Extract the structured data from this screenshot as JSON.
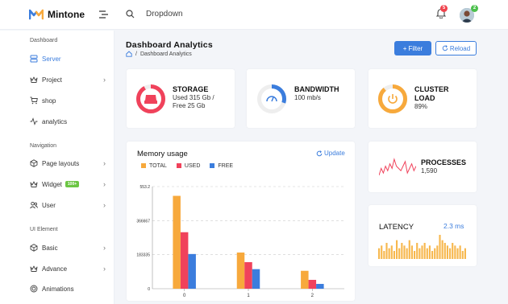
{
  "app": {
    "name": "Mintone"
  },
  "header": {
    "search_placeholder": "Dropdown",
    "notifications_count": "5",
    "profile_badge": "2"
  },
  "sidebar": {
    "sections": [
      {
        "title": "Dashboard"
      },
      {
        "title": "Navigation"
      },
      {
        "title": "UI Element"
      }
    ],
    "items": [
      {
        "label": "Server",
        "icon": "server-icon"
      },
      {
        "label": "Project",
        "icon": "crown-icon"
      },
      {
        "label": "shop",
        "icon": "cart-icon"
      },
      {
        "label": "analytics",
        "icon": "pulse-icon"
      },
      {
        "label": "Page layouts",
        "icon": "box-icon"
      },
      {
        "label": "Widget",
        "icon": "crown-icon",
        "tag": "100+"
      },
      {
        "label": "User",
        "icon": "users-icon"
      },
      {
        "label": "Basic",
        "icon": "box-icon"
      },
      {
        "label": "Advance",
        "icon": "crown-icon"
      },
      {
        "label": "Animations",
        "icon": "target-icon"
      }
    ]
  },
  "page": {
    "title": "Dashboard Analytics",
    "breadcrumb": {
      "sep": "/",
      "current": "Dashboard Analytics"
    },
    "filter_label": "Filter",
    "reload_label": "Reload"
  },
  "stats": {
    "storage": {
      "title": "STORAGE",
      "line1": "Used 315 Gb /",
      "line2": "Free 25 Gb",
      "color": "#f0425b",
      "progress": 0.92
    },
    "bandwidth": {
      "title": "BANDWIDTH",
      "value": "100 mb/s",
      "color": "#3b7ddd",
      "progress": 0.3
    },
    "cluster": {
      "title1": "CLUSTER",
      "title2": "LOAD",
      "value": "89%",
      "color": "#f7a93c",
      "progress": 0.89
    },
    "processes": {
      "title": "PROCESSES",
      "value": "1,590",
      "color": "#f0425b"
    },
    "latency": {
      "title": "LATENCY",
      "value": "2.3 ms",
      "color": "#f7b84e"
    }
  },
  "memory": {
    "title": "Memory usage",
    "update_label": "Update",
    "legend": [
      {
        "label": "TOTAL",
        "color": "#f7a93c"
      },
      {
        "label": "USED",
        "color": "#f0425b"
      },
      {
        "label": "FREE",
        "color": "#3b7ddd"
      }
    ]
  },
  "chart_data": {
    "type": "bar",
    "categories": [
      "0",
      "1",
      "2"
    ],
    "series": [
      {
        "name": "TOTAL",
        "values": [
          503,
          196,
          97
        ]
      },
      {
        "name": "USED",
        "values": [
          306,
          144,
          48
        ]
      },
      {
        "name": "FREE",
        "values": [
          188,
          106,
          26
        ]
      }
    ],
    "ylim": [
      0,
      553.2
    ],
    "yticks": [
      "0",
      "183335",
      "366667",
      "553.2"
    ],
    "grid": true
  },
  "processes_spark": [
    2,
    5,
    3,
    6,
    4,
    7,
    5,
    9,
    6,
    5,
    4,
    6,
    8,
    3,
    5,
    7,
    4,
    6
  ],
  "latency_spark": [
    4,
    5,
    3,
    6,
    4,
    5,
    3,
    7,
    4,
    6,
    5,
    4,
    7,
    5,
    3,
    6,
    4,
    5,
    6,
    4,
    5,
    3,
    4,
    5,
    9,
    7,
    6,
    5,
    4,
    6,
    5,
    4,
    5,
    3,
    4
  ]
}
